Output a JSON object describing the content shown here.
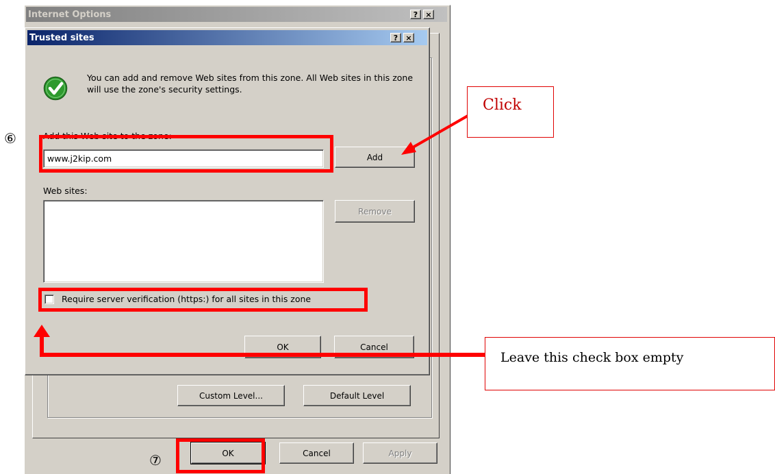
{
  "outer_window": {
    "title": "Internet Options",
    "buttons": {
      "custom_level": "Custom Level...",
      "default_level": "Default Level",
      "ok": "OK",
      "cancel": "Cancel",
      "apply": "Apply"
    }
  },
  "dialog": {
    "title": "Trusted sites",
    "info_text": "You can add and remove Web sites from this zone. All Web sites in this zone will use the zone's security settings.",
    "add_label": "Add this Web site to the zone:",
    "site_input_value": "www.j2kip.com",
    "add_button": "Add",
    "websites_label": "Web sites:",
    "websites_list": [],
    "remove_button": "Remove",
    "checkbox_label": "Require server verification (https:) for all sites in this zone",
    "checkbox_checked": false,
    "ok_button": "OK",
    "cancel_button": "Cancel"
  },
  "titlebar_controls": {
    "help": "?",
    "close": "×"
  },
  "annotations": {
    "step6": "⑥",
    "step7": "⑦",
    "click_callout": "Click",
    "checkbox_callout": "Leave this check box empty",
    "highlight_color": "#ff0000"
  },
  "colors": {
    "dialog_face": "#d4d0c8",
    "active_title_start": "#0a246a",
    "active_title_end": "#a6caf0",
    "inactive_title_start": "#808080",
    "inactive_title_end": "#c0c0c0",
    "check_green": "#2e9a2e"
  }
}
